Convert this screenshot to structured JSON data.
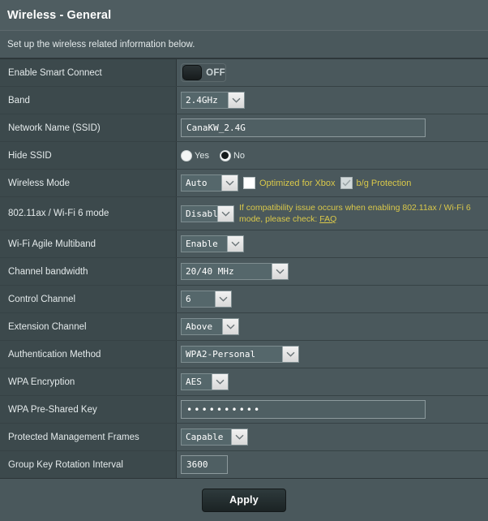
{
  "header": {
    "title": "Wireless - General",
    "subtitle": "Set up the wireless related information below."
  },
  "rows": {
    "smart_connect": {
      "label": "Enable Smart Connect",
      "toggle_state": "OFF"
    },
    "band": {
      "label": "Band",
      "value": "2.4GHz"
    },
    "ssid": {
      "label": "Network Name (SSID)",
      "value": "CanaKW_2.4G"
    },
    "hide_ssid": {
      "label": "Hide SSID",
      "option_yes": "Yes",
      "option_no": "No",
      "selected": "No"
    },
    "wireless_mode": {
      "label": "Wireless Mode",
      "value": "Auto",
      "xbox_label": "Optimized for Xbox",
      "xbox_checked": false,
      "bg_label": "b/g Protection",
      "bg_checked": true
    },
    "ax_mode": {
      "label": "802.11ax / Wi-Fi 6 mode",
      "value": "Disabl",
      "hint_text": "If compatibility issue occurs when enabling 802.11ax / Wi-Fi 6 mode, please check: ",
      "hint_link": "FAQ"
    },
    "agile_multiband": {
      "label": "Wi-Fi Agile Multiband",
      "value": "Enable"
    },
    "channel_bandwidth": {
      "label": "Channel bandwidth",
      "value": "20/40 MHz"
    },
    "control_channel": {
      "label": "Control Channel",
      "value": "6"
    },
    "extension_channel": {
      "label": "Extension Channel",
      "value": "Above"
    },
    "auth_method": {
      "label": "Authentication Method",
      "value": "WPA2-Personal"
    },
    "wpa_encryption": {
      "label": "WPA Encryption",
      "value": "AES"
    },
    "psk": {
      "label": "WPA Pre-Shared Key",
      "value": "••••••••••"
    },
    "pmf": {
      "label": "Protected Management Frames",
      "value": "Capable"
    },
    "group_key": {
      "label": "Group Key Rotation Interval",
      "value": "3600"
    }
  },
  "footer": {
    "apply_label": "Apply"
  },
  "colors": {
    "panel_bg": "#4a585c",
    "label_bg": "#3c494c",
    "header_bg": "#4f5d61",
    "hint_yellow": "#d9c84a",
    "text": "#e8eced"
  }
}
